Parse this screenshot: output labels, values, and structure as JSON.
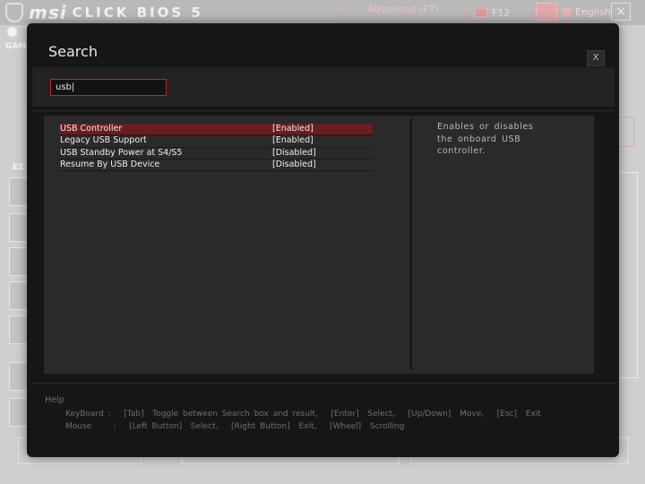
{
  "background": {
    "brand": "msi",
    "product": "CLICK BIOS 5",
    "mode_button": "Advanced (F7)",
    "f12_label": "F12",
    "language_label": "English",
    "game_label": "GAM",
    "ez_label": "EZ"
  },
  "dialog": {
    "title": "Search",
    "close_label": "X",
    "search_value": "usb|",
    "results": [
      {
        "name": "USB Controller",
        "value": "[Enabled]",
        "selected": true
      },
      {
        "name": "Legacy USB Support",
        "value": "[Enabled]",
        "selected": false
      },
      {
        "name": "USB Standby Power at S4/S5",
        "value": "[Disabled]",
        "selected": false
      },
      {
        "name": "Resume By USB Device",
        "value": "[Disabled]",
        "selected": false
      }
    ],
    "description": "Enables or disables the onboard USB controller.",
    "help": {
      "title": "Help",
      "keyboard": "KeyBoard :   [Tab]  Toggle between Search box and result,   [Enter]  Select,   [Up/Down]  Move,   [Esc]  Exit",
      "mouse": "Mouse     :   [Left Button]  Select,   [Right Button]  Exit,   [Wheel]  Scrolling"
    }
  },
  "colors": {
    "accent_red": "#c8202a",
    "selected_row": "#6d1c1c",
    "dialog_bg": "#161616"
  }
}
